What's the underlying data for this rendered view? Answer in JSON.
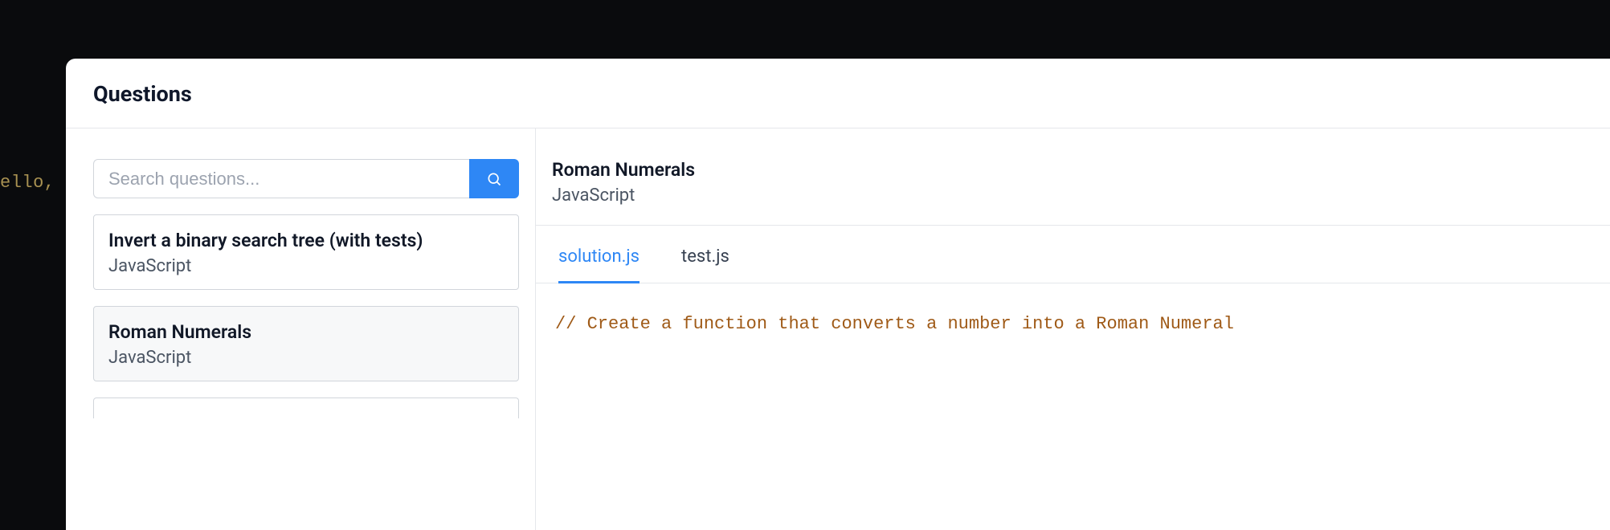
{
  "background_code": "ello,",
  "header": {
    "title": "Questions"
  },
  "search": {
    "placeholder": "Search questions...",
    "value": ""
  },
  "questions": [
    {
      "title": "Invert a binary search tree (with tests)",
      "language": "JavaScript",
      "selected": false
    },
    {
      "title": "Roman Numerals",
      "language": "JavaScript",
      "selected": true
    }
  ],
  "detail": {
    "title": "Roman Numerals",
    "language": "JavaScript",
    "tabs": [
      {
        "label": "solution.js",
        "active": true
      },
      {
        "label": "test.js",
        "active": false
      }
    ],
    "code": "// Create a function that converts a number into a Roman Numeral"
  }
}
